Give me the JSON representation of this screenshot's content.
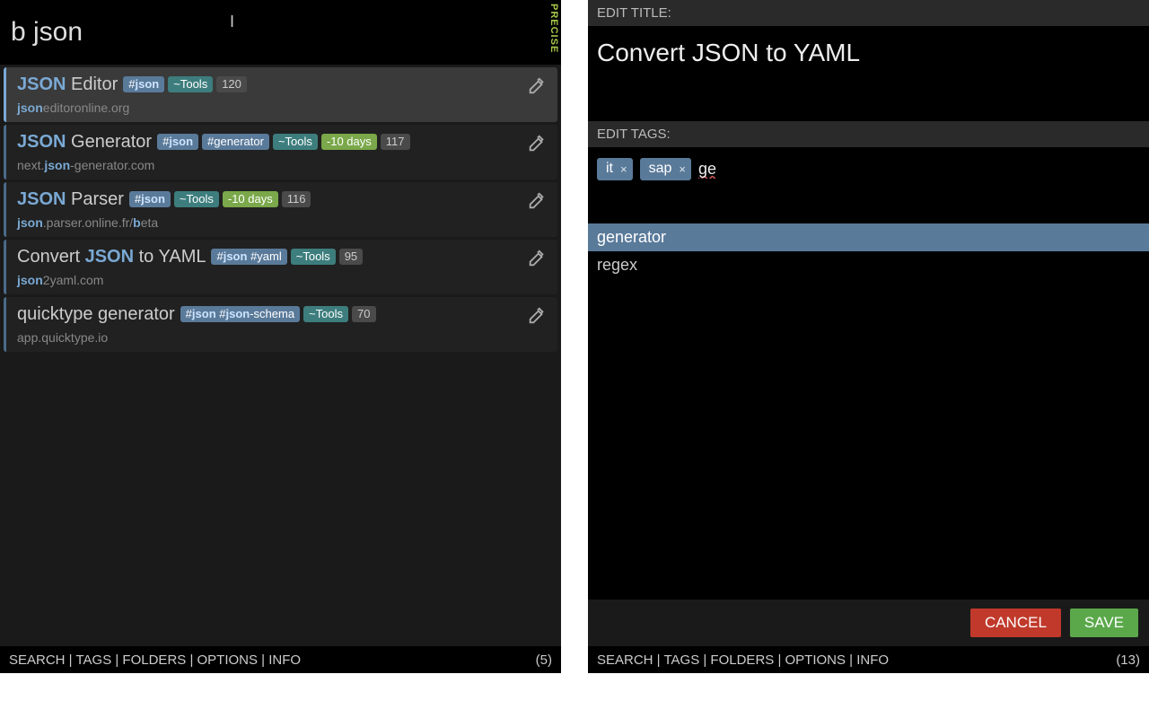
{
  "left": {
    "search_value": "b json",
    "mode_label": "PRECISE",
    "results": [
      {
        "title_pre": "",
        "title_hl": "JSON",
        "title_post": " Editor",
        "tags": [
          {
            "text_pre": "#",
            "text_hl": "json",
            "text_post": ""
          }
        ],
        "folder": "~Tools",
        "age": "",
        "count": "120",
        "url_pre": "",
        "url_hl": "json",
        "url_post": "editoronline.org",
        "selected": true
      },
      {
        "title_pre": "",
        "title_hl": "JSON",
        "title_post": " Generator",
        "tags": [
          {
            "text_pre": "#",
            "text_hl": "json",
            "text_post": ""
          },
          {
            "text_pre": "#generator",
            "text_hl": "",
            "text_post": ""
          }
        ],
        "folder": "~Tools",
        "age": "-10 days",
        "count": "117",
        "url_pre": "next.",
        "url_hl": "json",
        "url_post": "-generator.com",
        "selected": false
      },
      {
        "title_pre": "",
        "title_hl": "JSON",
        "title_post": " Parser",
        "tags": [
          {
            "text_pre": "#",
            "text_hl": "json",
            "text_post": ""
          }
        ],
        "folder": "~Tools",
        "age": "-10 days",
        "count": "116",
        "url_pre": "",
        "url_hl": "json",
        "url_post": ".parser.online.fr/",
        "url_hl2": "b",
        "url_post2": "eta",
        "selected": false
      },
      {
        "title_pre": "Convert ",
        "title_hl": "JSON",
        "title_post": " to YAML",
        "tags": [
          {
            "text_pre": "#",
            "text_hl": "json",
            "text_post": " #yaml"
          }
        ],
        "folder": "~Tools",
        "age": "",
        "count": "95",
        "url_pre": "",
        "url_hl": "json",
        "url_post": "2yaml.com",
        "selected": false
      },
      {
        "title_pre": "quicktype generator",
        "title_hl": "",
        "title_post": "",
        "tags": [
          {
            "text_pre": "#",
            "text_hl": "json",
            "text_post": " #"
          },
          {
            "text_pre": "",
            "text_hl": "json",
            "text_post": "-schema",
            "merge": true
          }
        ],
        "folder": "~Tools",
        "age": "",
        "count": "70",
        "url_pre": "app.quicktype.io",
        "url_hl": "",
        "url_post": "",
        "selected": false
      }
    ],
    "footer_links": "SEARCH | TAGS | FOLDERS | OPTIONS | INFO",
    "footer_count": "(5)"
  },
  "right": {
    "edit_title_label": "EDIT TITLE:",
    "title_value": "Convert JSON to YAML",
    "edit_tags_label": "EDIT TAGS:",
    "chips": [
      "it",
      "sap"
    ],
    "tag_input_value": "ge",
    "suggestions": [
      {
        "label": "generator",
        "selected": true
      },
      {
        "label": "regex",
        "selected": false
      }
    ],
    "cancel_label": "CANCEL",
    "save_label": "SAVE",
    "footer_links": "SEARCH | TAGS | FOLDERS | OPTIONS | INFO",
    "footer_count": "(13)"
  }
}
